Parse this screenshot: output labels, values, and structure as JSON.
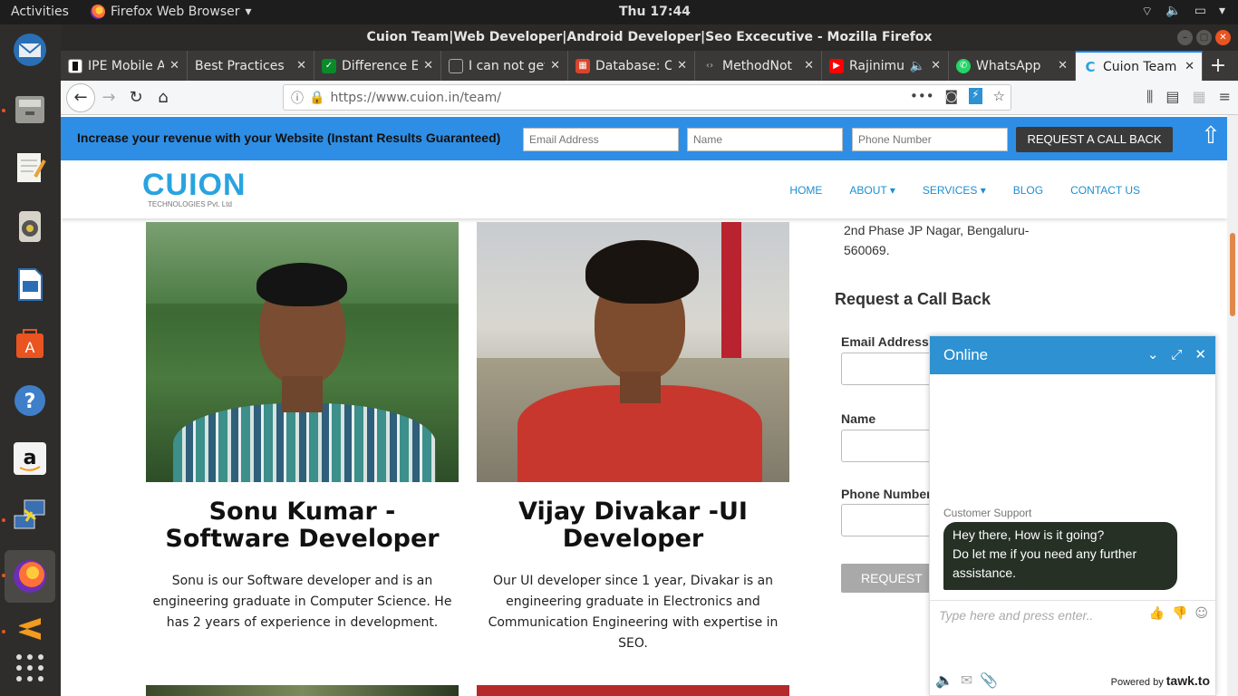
{
  "topbar": {
    "activities": "Activities",
    "app_name": "Firefox Web Browser",
    "clock": "Thu 17:44"
  },
  "window": {
    "title": "Cuion Team|Web Developer|Android Developer|Seo Excecutive - Mozilla Firefox"
  },
  "tabs": [
    {
      "label": "IPE Mobile A"
    },
    {
      "label": "Best Practices"
    },
    {
      "label": "Difference E"
    },
    {
      "label": "I can not get"
    },
    {
      "label": "Database: C"
    },
    {
      "label": "MethodNot"
    },
    {
      "label": "Rajinimur"
    },
    {
      "label": "WhatsApp"
    },
    {
      "label": "Cuion Team"
    }
  ],
  "navbar": {
    "url": "https://www.cuion.in/team/"
  },
  "promo": {
    "text": "Increase your revenue with your Website (Instant Results Guaranteed)",
    "email_placeholder": "Email Address",
    "name_placeholder": "Name",
    "phone_placeholder": "Phone Number",
    "button": "REQUEST A CALL BACK"
  },
  "site": {
    "logo": "CUION",
    "logo_sub": "TECHNOLOGIES Pvt. Ltd",
    "menu": [
      "HOME",
      "ABOUT ▾",
      "SERVICES ▾",
      "BLOG",
      "CONTACT US"
    ]
  },
  "members": [
    {
      "name": "Sonu Kumar - Software Developer",
      "bio": "Sonu is our Software developer and is an engineering graduate in Computer Science. He has 2 years of experience in development."
    },
    {
      "name": "Vijay Divakar -UI Developer",
      "bio": "Our UI developer since 1 year, Divakar is an engineering graduate in Electronics and Communication Engineering with expertise in SEO."
    }
  ],
  "sidebar": {
    "address_line1": "2nd Phase JP Nagar, Bengaluru-",
    "address_line2": "560069.",
    "request_title": "Request a Call Back",
    "email_label": "Email Address",
    "name_label": "Name",
    "phone_label": "Phone Number",
    "request_button": "REQUEST"
  },
  "chat": {
    "status": "Online",
    "agent": "Customer Support",
    "message_line1": "Hey there, How is it going?",
    "message_line2": "Do let me if you need any further assistance.",
    "input_placeholder": "Type here and press enter..",
    "powered_by": "Powered by",
    "brand": "tawk.to"
  }
}
